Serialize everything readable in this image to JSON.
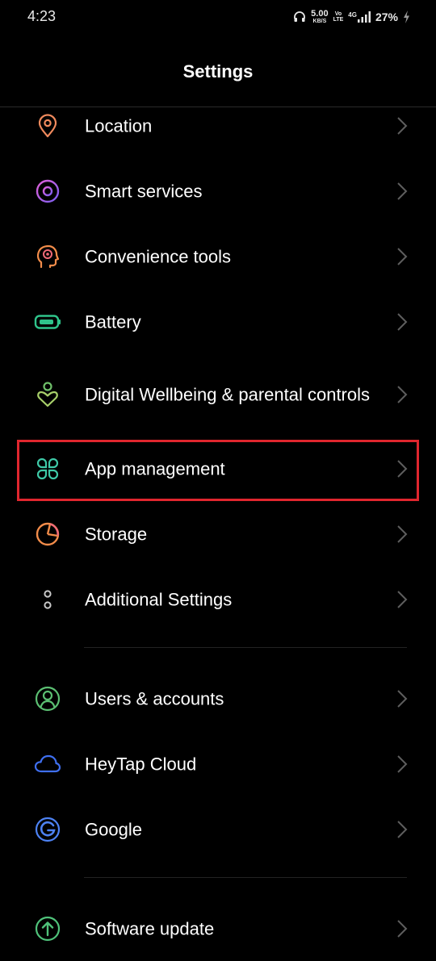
{
  "status_bar": {
    "time": "4:23",
    "speed_value": "5.00",
    "speed_unit": "KB/S",
    "volte_top": "Vo",
    "volte_bottom": "LTE",
    "network": "4G",
    "battery_percent": "27%"
  },
  "header": {
    "title": "Settings"
  },
  "settings": {
    "items": [
      {
        "label": "Location",
        "icon": "location-pin-icon",
        "color": "#f08a5d"
      },
      {
        "label": "Smart services",
        "icon": "smart-services-icon",
        "color": "#b15ce8"
      },
      {
        "label": "Convenience tools",
        "icon": "convenience-tools-icon",
        "color": "#f28c4a"
      },
      {
        "label": "Battery",
        "icon": "battery-icon",
        "color": "#2fc48b"
      },
      {
        "label": "Digital Wellbeing & parental controls",
        "icon": "wellbeing-icon",
        "color": "#7fc47a"
      },
      {
        "label": "App management",
        "icon": "app-grid-icon",
        "color": "#3ec9a7"
      },
      {
        "label": "Storage",
        "icon": "storage-pie-icon",
        "color": "#f28c4a"
      },
      {
        "label": "Additional Settings",
        "icon": "more-dots-icon",
        "color": "#c8c8c8"
      },
      {
        "label": "Users & accounts",
        "icon": "user-icon",
        "color": "#5bbf72"
      },
      {
        "label": "HeyTap Cloud",
        "icon": "cloud-icon",
        "color": "#3f6ff0"
      },
      {
        "label": "Google",
        "icon": "google-icon",
        "color": "#4d82f3"
      },
      {
        "label": "Software update",
        "icon": "update-arrow-icon",
        "color": "#4fc27a"
      }
    ]
  },
  "highlight": {
    "target": "App management",
    "color": "#e0262e"
  }
}
